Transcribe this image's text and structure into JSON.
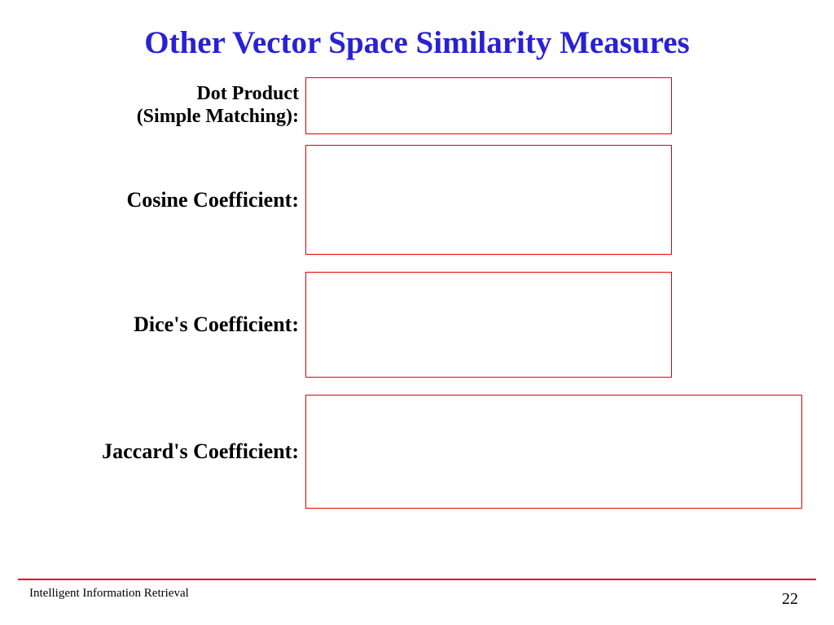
{
  "title": "Other Vector Space Similarity Measures",
  "measures": [
    {
      "label": "Dot Product\n(Simple Matching):"
    },
    {
      "label": "Cosine Coefficient:"
    },
    {
      "label": "Dice's Coefficient:"
    },
    {
      "label": "Jaccard's Coefficient:"
    }
  ],
  "footer": {
    "left": "Intelligent Information Retrieval",
    "page": "22"
  }
}
